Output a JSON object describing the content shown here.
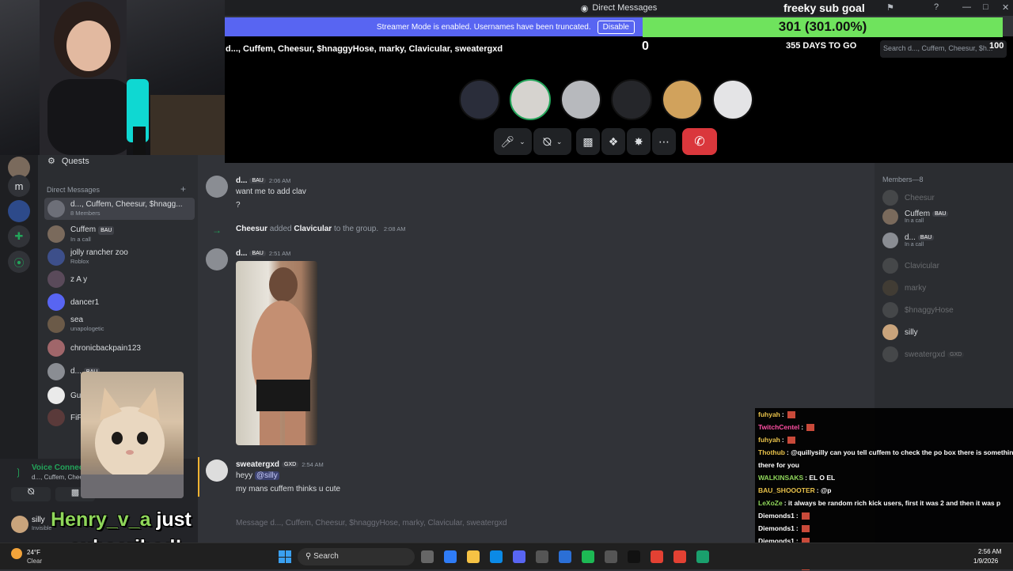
{
  "window": {
    "title": "Direct Messages"
  },
  "banner": {
    "text": "Streamer Mode is enabled. Usernames have been truncated.",
    "button": "Disable"
  },
  "goal": {
    "title": "freeky sub goal",
    "progress": "301 (301.00%)",
    "progress_fraction": 1.0,
    "min": "0",
    "days_left": "355 DAYS TO GO",
    "max": "100",
    "color": "#6fe35d"
  },
  "call": {
    "group_title": "d..., Cuffem, Cheesur, $hnaggyHose, marky, Clavicular, sweatergxd",
    "search_placeholder": "Search d..., Cuffem, Cheesur, $h...",
    "avatars": [
      "#2a2d3a",
      "#d6d3cf",
      "#b7b9bd",
      "#25262a",
      "#d1a25c",
      "#e4e4e6"
    ]
  },
  "sidebar": {
    "quests": "Quests",
    "dm_header": "Direct Messages",
    "items": [
      {
        "name": "d..., Cuffem, Cheesur, $hnagg...",
        "sub": "8 Members",
        "color": "#6d6f78"
      },
      {
        "name": "Cuffem",
        "badge": "BAU",
        "sub": "In a call",
        "color": "#7a6a5c"
      },
      {
        "name": "jolly rancher zoo",
        "sub": "Roblox",
        "color": "#3d4f8a"
      },
      {
        "name": "z A y",
        "sub": "",
        "color": "#5a4a5a"
      },
      {
        "name": "dancer1",
        "sub": "",
        "color": "#5865f2"
      },
      {
        "name": "sea",
        "sub": "unapologetic",
        "color": "#6b5a48"
      },
      {
        "name": "chronicbackpain123",
        "sub": "",
        "color": "#a0666a"
      },
      {
        "name": "d...",
        "badge": "BAU",
        "sub": "",
        "color": "#8a8d93"
      },
      {
        "name": "Gu",
        "sub": "",
        "color": "#eaeaea"
      },
      {
        "name": "FiF",
        "sub": "",
        "color": "#5a3a3a"
      }
    ],
    "rail_letter": "m"
  },
  "chat": {
    "messages": [
      {
        "author": "d...",
        "badge": "BAU",
        "time": "2:06 AM",
        "lines": [
          "want me to add clav",
          "?"
        ]
      },
      {
        "system": true,
        "actor": "Cheesur",
        "action": "added",
        "target": "Clavicular",
        "rest": "to the group.",
        "time": "2:08 AM"
      },
      {
        "author": "d...",
        "badge": "BAU",
        "time": "2:51 AM",
        "image": true
      },
      {
        "author": "sweatergxd",
        "badge": "GXD",
        "time": "2:54 AM",
        "lines": [
          "heyy",
          "my mans cuffem thinks u cute"
        ],
        "mention": "@silly"
      }
    ],
    "input_placeholder": "Message d..., Cuffem, Cheesur, $hnaggyHose, marky, Clavicular, sweatergxd"
  },
  "members": {
    "header": "Members—8",
    "list": [
      {
        "name": "Cheesur",
        "dim": true
      },
      {
        "name": "Cuffem",
        "badge": "BAU",
        "sub": "In a call"
      },
      {
        "name": "d...",
        "badge": "BAU",
        "sub": "In a call"
      },
      {
        "name": "Clavicular",
        "dim": true
      },
      {
        "name": "marky",
        "dim": true
      },
      {
        "name": "$hnaggyHose",
        "dim": true
      },
      {
        "name": "silly"
      },
      {
        "name": "sweatergxd",
        "badge": "GXD",
        "dim": true
      }
    ]
  },
  "twitch_chat": [
    {
      "user": "fuhyah",
      "text": "",
      "color": "#e9c24a"
    },
    {
      "user": "TwitchCentel",
      "text": "",
      "color": "#ff4fa3"
    },
    {
      "user": "fuhyah",
      "text": "",
      "color": "#e9c24a"
    },
    {
      "user": "Thothub",
      "text": "@quillysilly can you tell cuffem to check the po box there is something in",
      "color": "#e9c24a"
    },
    {
      "user": "",
      "text": "there for you",
      "color": "#ffffff"
    },
    {
      "user": "WALKINSAKS",
      "text": "EL O EL",
      "color": "#8fd65a"
    },
    {
      "user": "BAU_SHOOOTER",
      "text": "@p",
      "color": "#e9c24a"
    },
    {
      "user": "LeXoZe",
      "text": "it always be random rich kick users, first it was 2 and then it was p",
      "color": "#8fd65a"
    },
    {
      "user": "Diemonds1",
      "text": "",
      "color": "#ffffff"
    },
    {
      "user": "Diemonds1",
      "text": "",
      "color": "#ffffff"
    },
    {
      "user": "Diemonds1",
      "text": "",
      "color": "#ffffff"
    },
    {
      "user": "Diemonds1",
      "text": "",
      "color": "#ffffff"
    },
    {
      "user": "Diemonds1",
      "text": "",
      "color": "#ffffff"
    }
  ],
  "voice": {
    "status": "Voice Connec",
    "channel": "d..., Cuffem, Chee",
    "user": "silly",
    "user_status": "Invisible"
  },
  "subscribed": {
    "name": "Henry_v_a",
    "text1": "just",
    "text2": "subscribed!"
  },
  "taskbar": {
    "weather_temp": "24°F",
    "weather_desc": "Clear",
    "search": "Search",
    "time": "2:56 AM",
    "date": "1/9/2026"
  }
}
